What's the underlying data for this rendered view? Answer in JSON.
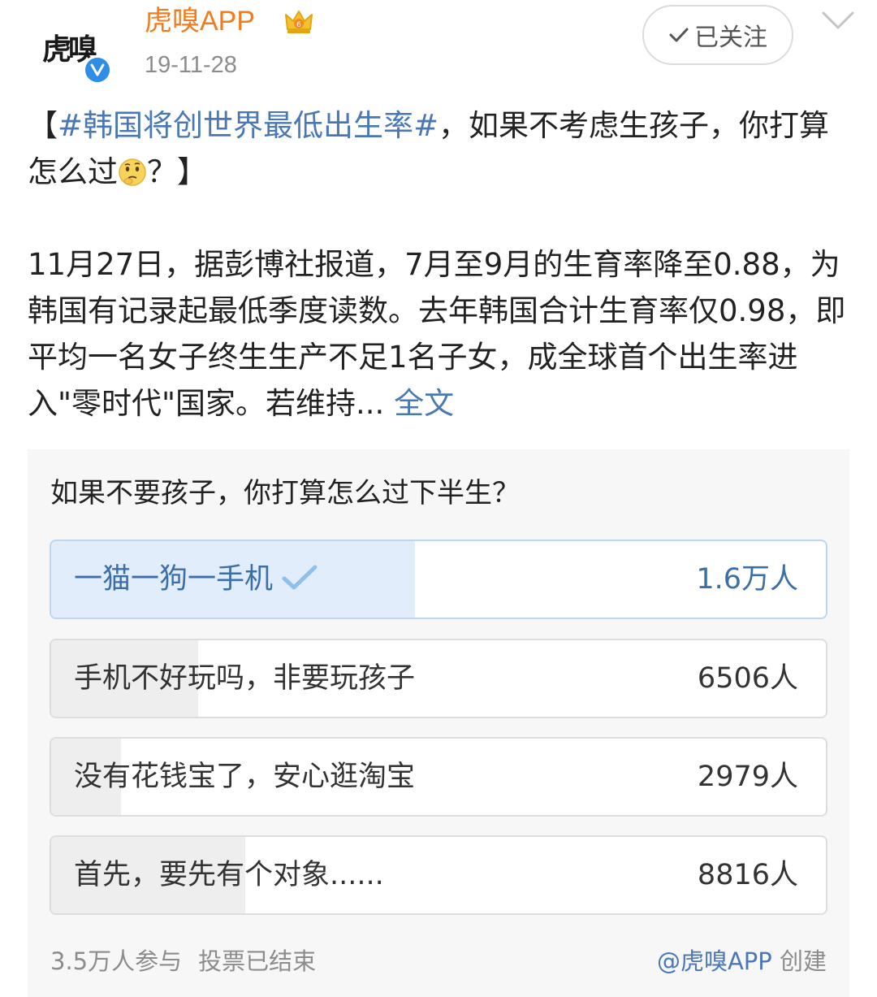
{
  "header": {
    "avatar_text": "虎嗅",
    "username": "虎嗅APP",
    "time": "19-11-28",
    "follow_label": "已关注",
    "vip_icon": "crown-vip-icon",
    "verified_icon": "verified-v-icon"
  },
  "post": {
    "bracket_open": "【",
    "topic": "#韩国将创世界最低出生率#",
    "headline_rest": "，如果不考虑生孩子，你打算怎么过",
    "emoji_name": "thinking-emoji",
    "headline_end": "？】",
    "body": "11月27日，据彭博社报道，7月至9月的生育率降至0.88，为韩国有记录起最低季度读数。去年韩国合计生育率仅0.98，即平均一名女子终生生产不足1名子女，成全球首个出生率进入\"零时代\"国家。若维持...",
    "full_text_link": "全文"
  },
  "poll": {
    "question": "如果不要孩子，你打算怎么过下半生？",
    "options": [
      {
        "label": "一猫一狗一手机",
        "count": "1.6万人",
        "share": 0.47,
        "selected": true
      },
      {
        "label": "手机不好玩吗，非要玩孩子",
        "count": "6506人",
        "share": 0.19,
        "selected": false
      },
      {
        "label": "没有花钱宝了，安心逛淘宝",
        "count": "2979人",
        "share": 0.09,
        "selected": false
      },
      {
        "label": "首先，要先有个对象......",
        "count": "8816人",
        "share": 0.25,
        "selected": false
      }
    ],
    "participants": "3.5万人参与",
    "status": "投票已结束",
    "creator": "@虎嗅APP",
    "created_label": "创建"
  },
  "colors": {
    "username": "#f07c1d",
    "link": "#4a78b5",
    "selected_fill": "#e1edfa",
    "unselected_fill": "#eeeeee"
  }
}
